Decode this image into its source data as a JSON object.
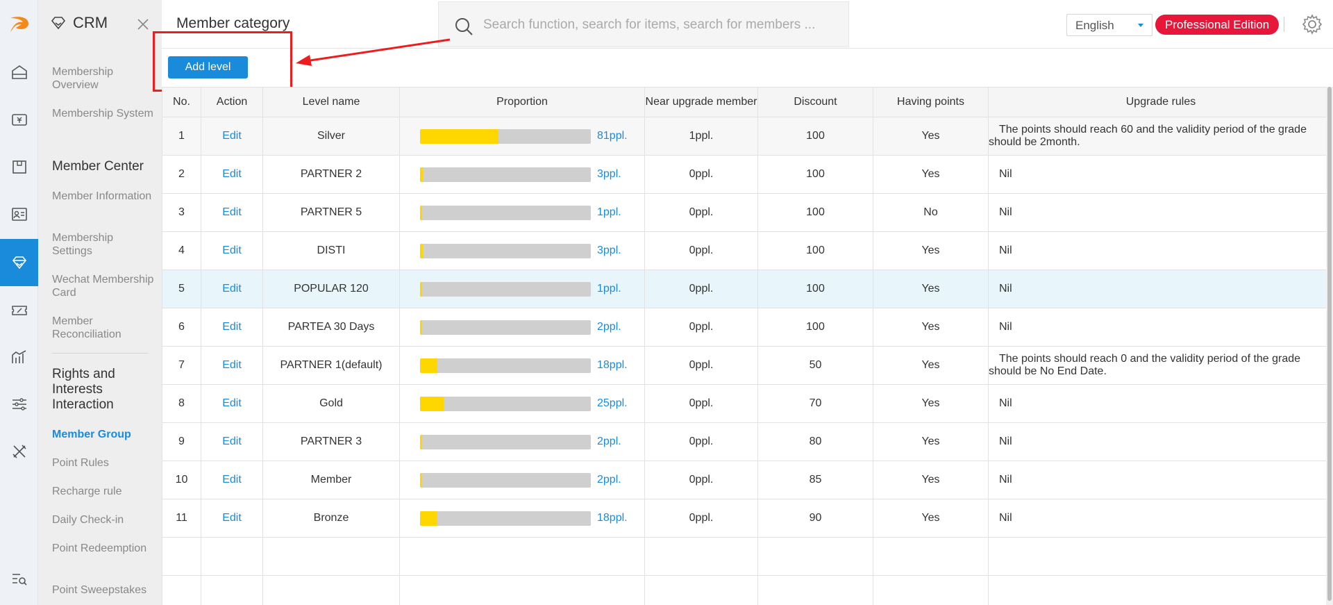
{
  "rail": {
    "items": [
      {
        "icon": "home-icon"
      },
      {
        "icon": "cashier-icon"
      },
      {
        "icon": "goods-box-icon"
      },
      {
        "icon": "member-card-icon"
      },
      {
        "icon": "diamond-icon"
      },
      {
        "icon": "coupon-icon"
      },
      {
        "icon": "chart-icon"
      },
      {
        "icon": "sliders-icon"
      },
      {
        "icon": "tools-icon"
      },
      {
        "icon": "search-list-icon"
      }
    ]
  },
  "menu": {
    "title": "CRM",
    "items": [
      {
        "label": "Membership Overview"
      },
      {
        "label": "Membership System"
      },
      {
        "label": "Member Center"
      },
      {
        "label": "Member Information"
      },
      {
        "label": "Membership Settings"
      },
      {
        "label": "Wechat Membership Card"
      },
      {
        "label": "Member Reconciliation"
      },
      {
        "label": "Rights and Interests Interaction"
      },
      {
        "label": "Member Group"
      },
      {
        "label": "Point Rules"
      },
      {
        "label": "Recharge rule"
      },
      {
        "label": "Daily Check-in"
      },
      {
        "label": "Point Redeemption"
      },
      {
        "label": "Point Sweepstakes"
      }
    ]
  },
  "header": {
    "title": "Member category",
    "search_placeholder": "Search function, search for items, search for members ...",
    "language": "English",
    "edition": "Professional Edition"
  },
  "toolbar": {
    "add_label": "Add level"
  },
  "table": {
    "columns": [
      "No.",
      "Action",
      "Level name",
      "Proportion",
      "Near upgrade member",
      "Discount",
      "Having points",
      "Upgrade rules"
    ],
    "rows": [
      {
        "no": "1",
        "action": "Edit",
        "name": "Silver",
        "count": "81ppl.",
        "fill": 0.46,
        "near": "1ppl.",
        "discount": "100",
        "points": "Yes",
        "rules": "The points should reach 60 and the validity period of the grade should be 2month."
      },
      {
        "no": "2",
        "action": "Edit",
        "name": "PARTNER 2",
        "count": "3ppl.",
        "fill": 0.017,
        "near": "0ppl.",
        "discount": "100",
        "points": "Yes",
        "rules": "Nil"
      },
      {
        "no": "3",
        "action": "Edit",
        "name": "PARTNER 5",
        "count": "1ppl.",
        "fill": 0.006,
        "near": "0ppl.",
        "discount": "100",
        "points": "No",
        "rules": "Nil"
      },
      {
        "no": "4",
        "action": "Edit",
        "name": "DISTI",
        "count": "3ppl.",
        "fill": 0.017,
        "near": "0ppl.",
        "discount": "100",
        "points": "Yes",
        "rules": "Nil"
      },
      {
        "no": "5",
        "action": "Edit",
        "name": "POPULAR 120",
        "count": "1ppl.",
        "fill": 0.006,
        "near": "0ppl.",
        "discount": "100",
        "points": "Yes",
        "rules": "Nil"
      },
      {
        "no": "6",
        "action": "Edit",
        "name": "PARTEA 30 Days",
        "count": "2ppl.",
        "fill": 0.011,
        "near": "0ppl.",
        "discount": "100",
        "points": "Yes",
        "rules": "Nil"
      },
      {
        "no": "7",
        "action": "Edit",
        "name": "PARTNER 1(default)",
        "count": "18ppl.",
        "fill": 0.1,
        "near": "0ppl.",
        "discount": "50",
        "points": "Yes",
        "rules": "The points should reach 0 and the validity period of the grade should be No End Date."
      },
      {
        "no": "8",
        "action": "Edit",
        "name": "Gold",
        "count": "25ppl.",
        "fill": 0.14,
        "near": "0ppl.",
        "discount": "70",
        "points": "Yes",
        "rules": "Nil"
      },
      {
        "no": "9",
        "action": "Edit",
        "name": "PARTNER 3",
        "count": "2ppl.",
        "fill": 0.011,
        "near": "0ppl.",
        "discount": "80",
        "points": "Yes",
        "rules": "Nil"
      },
      {
        "no": "10",
        "action": "Edit",
        "name": "Member",
        "count": "2ppl.",
        "fill": 0.011,
        "near": "0ppl.",
        "discount": "85",
        "points": "Yes",
        "rules": "Nil"
      },
      {
        "no": "11",
        "action": "Edit",
        "name": "Bronze",
        "count": "18ppl.",
        "fill": 0.1,
        "near": "0ppl.",
        "discount": "90",
        "points": "Yes",
        "rules": "Nil"
      }
    ]
  },
  "colors": {
    "accent": "#1a8bdb",
    "badge": "#e8173a",
    "bar_fill": "#fed700",
    "bar_bg": "#cfcfcf",
    "highlight": "#ee1c1c"
  }
}
